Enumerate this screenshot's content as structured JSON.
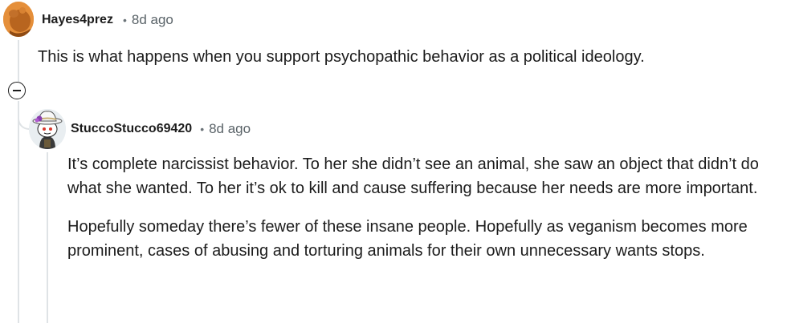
{
  "comments": [
    {
      "username": "Hayes4prez",
      "separator": "•",
      "time": "8d ago",
      "avatar_icon": "orange-avatar-icon",
      "body": "This is what happens when you support psychopathic behavior as a political ideology."
    },
    {
      "username": "StuccoStucco69420",
      "separator": "•",
      "time": "8d ago",
      "avatar_icon": "snoo-hat-avatar-icon",
      "paragraphs": [
        "It’s complete narcissist behavior. To her she didn’t see an animal, she saw an object that didn’t do what she wanted. To her it’s ok to kill and cause suffering because her needs are more important.",
        "Hopefully someday there’s fewer of these insane people. Hopefully as veganism becomes more prominent, cases of abusing and torturing animals for their own unnecessary wants stops."
      ]
    }
  ],
  "collapse_icon": "minus-circle-icon",
  "colors": {
    "thread_line": "#dfe3e6",
    "meta_text": "#5a6368",
    "text": "#1c1c1c",
    "avatar1_bg": "#e58f3a"
  }
}
